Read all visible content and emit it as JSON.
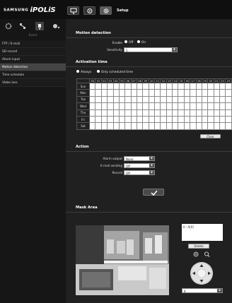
{
  "brand": {
    "samsung": "SAMSUNG",
    "ipolis": "iPOLiS"
  },
  "header": {
    "title": "Setup"
  },
  "sidebar": {
    "caption": "Event",
    "items": [
      {
        "label": "FTP / E-mail"
      },
      {
        "label": "SD record"
      },
      {
        "label": "Alarm input"
      },
      {
        "label": "Motion detection"
      },
      {
        "label": "Time schedule"
      },
      {
        "label": "Video loss"
      }
    ]
  },
  "motion": {
    "title": "Motion detection",
    "enable_label": "Enable",
    "off_label": "Off",
    "on_label": "On",
    "enable_value": "On",
    "sensitivity_label": "Sensitivity",
    "sensitivity_value": "1"
  },
  "activation": {
    "title": "Activation time",
    "always_label": "Always",
    "scheduled_label": "Only scheduled time",
    "selected": "Always",
    "hours": [
      "00",
      "01",
      "02",
      "03",
      "04",
      "05",
      "06",
      "07",
      "08",
      "09",
      "10",
      "11",
      "12",
      "13",
      "14",
      "15",
      "16",
      "17",
      "18",
      "19",
      "20",
      "21",
      "22",
      "23"
    ],
    "days": [
      "Sun",
      "Mon",
      "Tue",
      "Wed",
      "Thu",
      "Fri",
      "Sat"
    ],
    "clear_label": "Clear"
  },
  "action": {
    "title": "Action",
    "alarm_output_label": "Alarm output",
    "alarm_output_value": "None",
    "email_label": "E-mail sending",
    "email_value": "Off",
    "record_label": "Record",
    "record_value": "Off",
    "apply_icon": "checkmark-icon"
  },
  "mask": {
    "title": "Mask Area",
    "list_value": "0 : A[0]",
    "delete_label": "Delete",
    "select_value": "8"
  },
  "colors": {
    "background": "#202020",
    "topbar": "#0f0f0f",
    "sidebar_active": "#444444"
  }
}
